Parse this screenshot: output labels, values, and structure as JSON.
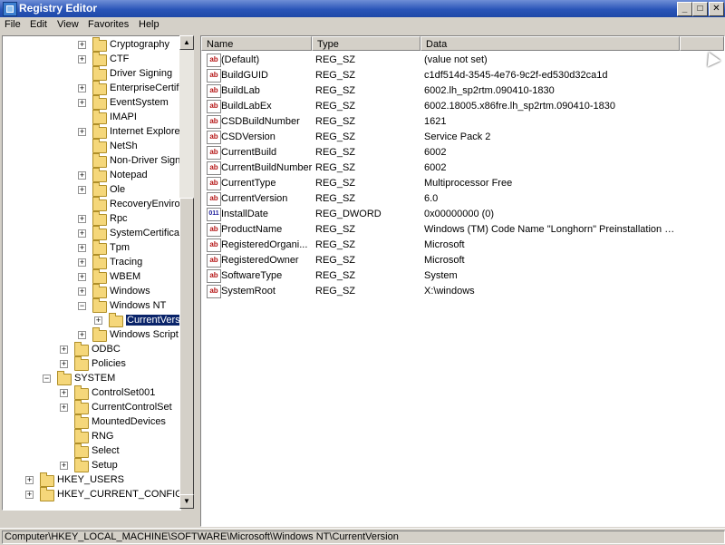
{
  "window": {
    "title": "Registry Editor",
    "buttons": {
      "minimize": "_",
      "maximize": "□",
      "close": "✕"
    }
  },
  "menu": [
    "File",
    "Edit",
    "View",
    "Favorites",
    "Help"
  ],
  "tree": [
    {
      "label": "Cryptography",
      "expander": "+",
      "folder": true
    },
    {
      "label": "CTF",
      "expander": "+",
      "folder": true
    },
    {
      "label": "Driver Signing",
      "expander": "",
      "folder": true
    },
    {
      "label": "EnterpriseCertif",
      "expander": "+",
      "folder": true
    },
    {
      "label": "EventSystem",
      "expander": "+",
      "folder": true
    },
    {
      "label": "IMAPI",
      "expander": "",
      "folder": true
    },
    {
      "label": "Internet Explore",
      "expander": "+",
      "folder": true
    },
    {
      "label": "NetSh",
      "expander": "",
      "folder": true
    },
    {
      "label": "Non-Driver Signi",
      "expander": "",
      "folder": true
    },
    {
      "label": "Notepad",
      "expander": "+",
      "folder": true
    },
    {
      "label": "Ole",
      "expander": "+",
      "folder": true
    },
    {
      "label": "RecoveryEnviror",
      "expander": "",
      "folder": true
    },
    {
      "label": "Rpc",
      "expander": "+",
      "folder": true
    },
    {
      "label": "SystemCertificat",
      "expander": "+",
      "folder": true
    },
    {
      "label": "Tpm",
      "expander": "+",
      "folder": true
    },
    {
      "label": "Tracing",
      "expander": "+",
      "folder": true
    },
    {
      "label": "WBEM",
      "expander": "+",
      "folder": true
    },
    {
      "label": "Windows",
      "expander": "+",
      "folder": true
    },
    {
      "label": "Windows NT",
      "expander": "−",
      "folder": true
    },
    {
      "label": "CurrentVersi",
      "expander": "+",
      "folder": true,
      "selected": true
    },
    {
      "label": "Windows Script I",
      "expander": "+",
      "folder": true
    },
    {
      "label": "ODBC",
      "expander": "+",
      "folder": true
    },
    {
      "label": "Policies",
      "expander": "+",
      "folder": true
    },
    {
      "label": "SYSTEM",
      "expander": "−",
      "folder": true
    },
    {
      "label": "ControlSet001",
      "expander": "+",
      "folder": true
    },
    {
      "label": "CurrentControlSet",
      "expander": "+",
      "folder": true
    },
    {
      "label": "MountedDevices",
      "expander": "",
      "folder": true
    },
    {
      "label": "RNG",
      "expander": "",
      "folder": true
    },
    {
      "label": "Select",
      "expander": "",
      "folder": true
    },
    {
      "label": "Setup",
      "expander": "+",
      "folder": true
    },
    {
      "label": "HKEY_USERS",
      "expander": "+",
      "folder": true
    },
    {
      "label": "HKEY_CURRENT_CONFIG",
      "expander": "+",
      "folder": true
    }
  ],
  "columns": [
    "Name",
    "Type",
    "Data"
  ],
  "values": [
    {
      "icon": "ab",
      "name": "(Default)",
      "type": "REG_SZ",
      "data": "(value not set)"
    },
    {
      "icon": "ab",
      "name": "BuildGUID",
      "type": "REG_SZ",
      "data": "c1df514d-3545-4e76-9c2f-ed530d32ca1d"
    },
    {
      "icon": "ab",
      "name": "BuildLab",
      "type": "REG_SZ",
      "data": "6002.lh_sp2rtm.090410-1830"
    },
    {
      "icon": "ab",
      "name": "BuildLabEx",
      "type": "REG_SZ",
      "data": "6002.18005.x86fre.lh_sp2rtm.090410-1830"
    },
    {
      "icon": "ab",
      "name": "CSDBuildNumber",
      "type": "REG_SZ",
      "data": "1621"
    },
    {
      "icon": "ab",
      "name": "CSDVersion",
      "type": "REG_SZ",
      "data": "Service Pack 2"
    },
    {
      "icon": "ab",
      "name": "CurrentBuild",
      "type": "REG_SZ",
      "data": "6002"
    },
    {
      "icon": "ab",
      "name": "CurrentBuildNumber",
      "type": "REG_SZ",
      "data": "6002"
    },
    {
      "icon": "ab",
      "name": "CurrentType",
      "type": "REG_SZ",
      "data": "Multiprocessor Free"
    },
    {
      "icon": "ab",
      "name": "CurrentVersion",
      "type": "REG_SZ",
      "data": "6.0"
    },
    {
      "icon": "011",
      "name": "InstallDate",
      "type": "REG_DWORD",
      "data": "0x00000000 (0)"
    },
    {
      "icon": "ab",
      "name": "ProductName",
      "type": "REG_SZ",
      "data": "Windows (TM) Code Name \"Longhorn\" Preinstallation E..."
    },
    {
      "icon": "ab",
      "name": "RegisteredOrgani...",
      "type": "REG_SZ",
      "data": "Microsoft"
    },
    {
      "icon": "ab",
      "name": "RegisteredOwner",
      "type": "REG_SZ",
      "data": "Microsoft"
    },
    {
      "icon": "ab",
      "name": "SoftwareType",
      "type": "REG_SZ",
      "data": "System"
    },
    {
      "icon": "ab",
      "name": "SystemRoot",
      "type": "REG_SZ",
      "data": "X:\\windows"
    }
  ],
  "status": "Computer\\HKEY_LOCAL_MACHINE\\SOFTWARE\\Microsoft\\Windows NT\\CurrentVersion"
}
